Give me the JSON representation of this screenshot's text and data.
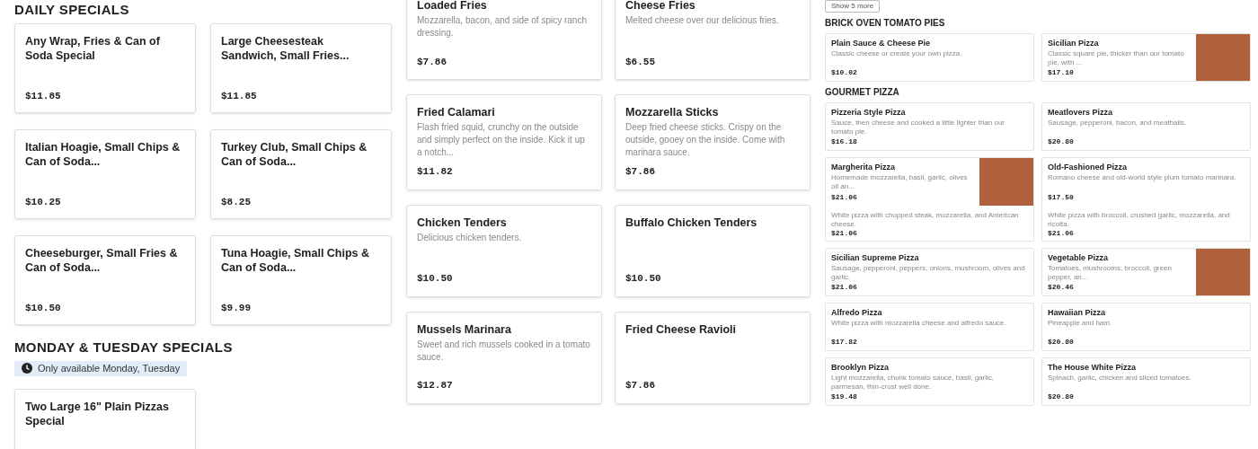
{
  "left": {
    "sections": [
      {
        "title": "DAILY SPECIALS",
        "items": [
          {
            "name": "Any Wrap, Fries & Can of Soda Special",
            "price": "$11.85"
          },
          {
            "name": "Large Cheesesteak Sandwich, Small Fries...",
            "price": "$11.85"
          },
          {
            "name": "Italian Hoagie, Small Chips & Can of Soda...",
            "price": "$10.25"
          },
          {
            "name": "Turkey Club, Small Chips & Can of Soda...",
            "price": "$8.25"
          },
          {
            "name": "Cheeseburger, Small Fries & Can of Soda...",
            "price": "$10.50"
          },
          {
            "name": "Tuna Hoagie, Small Chips & Can of Soda...",
            "price": "$9.99"
          }
        ]
      },
      {
        "title": "MONDAY & TUESDAY SPECIALS",
        "note": "Only available Monday, Tuesday",
        "items": [
          {
            "name": "Two Large 16\" Plain Pizzas Special"
          }
        ]
      }
    ]
  },
  "middle": {
    "items": [
      {
        "name": "Loaded Fries",
        "description": "Mozzarella, bacon, and side of spicy ranch dressing.",
        "price": "$7.86"
      },
      {
        "name": "Cheese Fries",
        "description": "Melted cheese over our delicious fries.",
        "price": "$6.55"
      },
      {
        "name": "Fried Calamari",
        "description": "Flash fried squid, crunchy on the outside and simply perfect on the inside. Kick it up a notch...",
        "price": "$11.82"
      },
      {
        "name": "Mozzarella Sticks",
        "description": "Deep fried cheese sticks. Crispy on the outside, gooey on the inside. Come with marinara sauce.",
        "price": "$7.86"
      },
      {
        "name": "Chicken Tenders",
        "description": "Delicious chicken tenders.",
        "price": "$10.50"
      },
      {
        "name": "Buffalo Chicken Tenders",
        "price": "$10.50"
      },
      {
        "name": "Mussels Marinara",
        "description": "Sweet and rich mussels cooked in a tomato sauce.",
        "price": "$12.87"
      },
      {
        "name": "Fried Cheese Ravioli",
        "price": "$7.86"
      }
    ]
  },
  "right": {
    "show_more_button": "Show 5 more",
    "sections": [
      {
        "title": "BRICK OVEN TOMATO PIES",
        "items": [
          {
            "kind": "card",
            "name": "Plain Sauce & Cheese Pie",
            "description": "Classic cheese or create your own pizza.",
            "price": "$10.02",
            "photo": false
          },
          {
            "kind": "card",
            "name": "Sicilian Pizza",
            "description": "Classic square pie, thicker than our tomato pie, with ...",
            "price": "$17.10",
            "photo": true
          }
        ]
      },
      {
        "title": "GOURMET PIZZA",
        "items": [
          {
            "kind": "card",
            "name": "Pizzeria Style Pizza",
            "description": "Sauce, then cheese and cooked a little lighter than our tomato pie.",
            "price": "$16.18",
            "photo": false
          },
          {
            "kind": "card",
            "name": "Meatlovers Pizza",
            "description": "Sausage, pepperoni, bacon, and meatballs.",
            "price": "$20.80",
            "photo": false
          },
          {
            "kind": "card",
            "name": "Margherita Pizza",
            "description": "Homemade mozzarella, basil, garlic, olives oil an...",
            "price": "$21.06",
            "photo": true
          },
          {
            "kind": "card",
            "name": "Old-Fashioned Pizza",
            "description": "Romano cheese and old-world style plum tomato marinara.",
            "price": "$17.50",
            "photo": false
          },
          {
            "kind": "continuation",
            "description": "White pizza with chopped steak, mozzarella, and American cheese.",
            "price": "$21.06"
          },
          {
            "kind": "continuation",
            "description": "White pizza with broccoli, crushed garlic, mozzarella, and ricotta.",
            "price": "$21.06"
          },
          {
            "kind": "card",
            "name": "Sicilian Supreme Pizza",
            "description": "Sausage, pepperoni, peppers, onions, mushroom, olives and garlic.",
            "price": "$21.06",
            "photo": false
          },
          {
            "kind": "card",
            "name": "Vegetable Pizza",
            "description": "Tomatoes, mushrooms, broccoli, green pepper, an...",
            "price": "$20.46",
            "photo": true
          },
          {
            "kind": "card",
            "name": "Alfredo Pizza",
            "description": "White pizza with mozzarella cheese and alfredo sauce.",
            "price": "$17.82",
            "photo": false
          },
          {
            "kind": "card",
            "name": "Hawaiian Pizza",
            "description": "Pineapple and ham.",
            "price": "$20.80",
            "photo": false
          },
          {
            "kind": "card",
            "name": "Brooklyn Pizza",
            "description": "Light mozzarella, chunk tomato sauce, basil, garlic, parmesan, thin-crust well done.",
            "price": "$19.48",
            "photo": false
          },
          {
            "kind": "card",
            "name": "The House White Pizza",
            "description": "Spinach, garlic, chicken and sliced tomatoes.",
            "price": "$20.80",
            "photo": false
          }
        ]
      }
    ]
  }
}
